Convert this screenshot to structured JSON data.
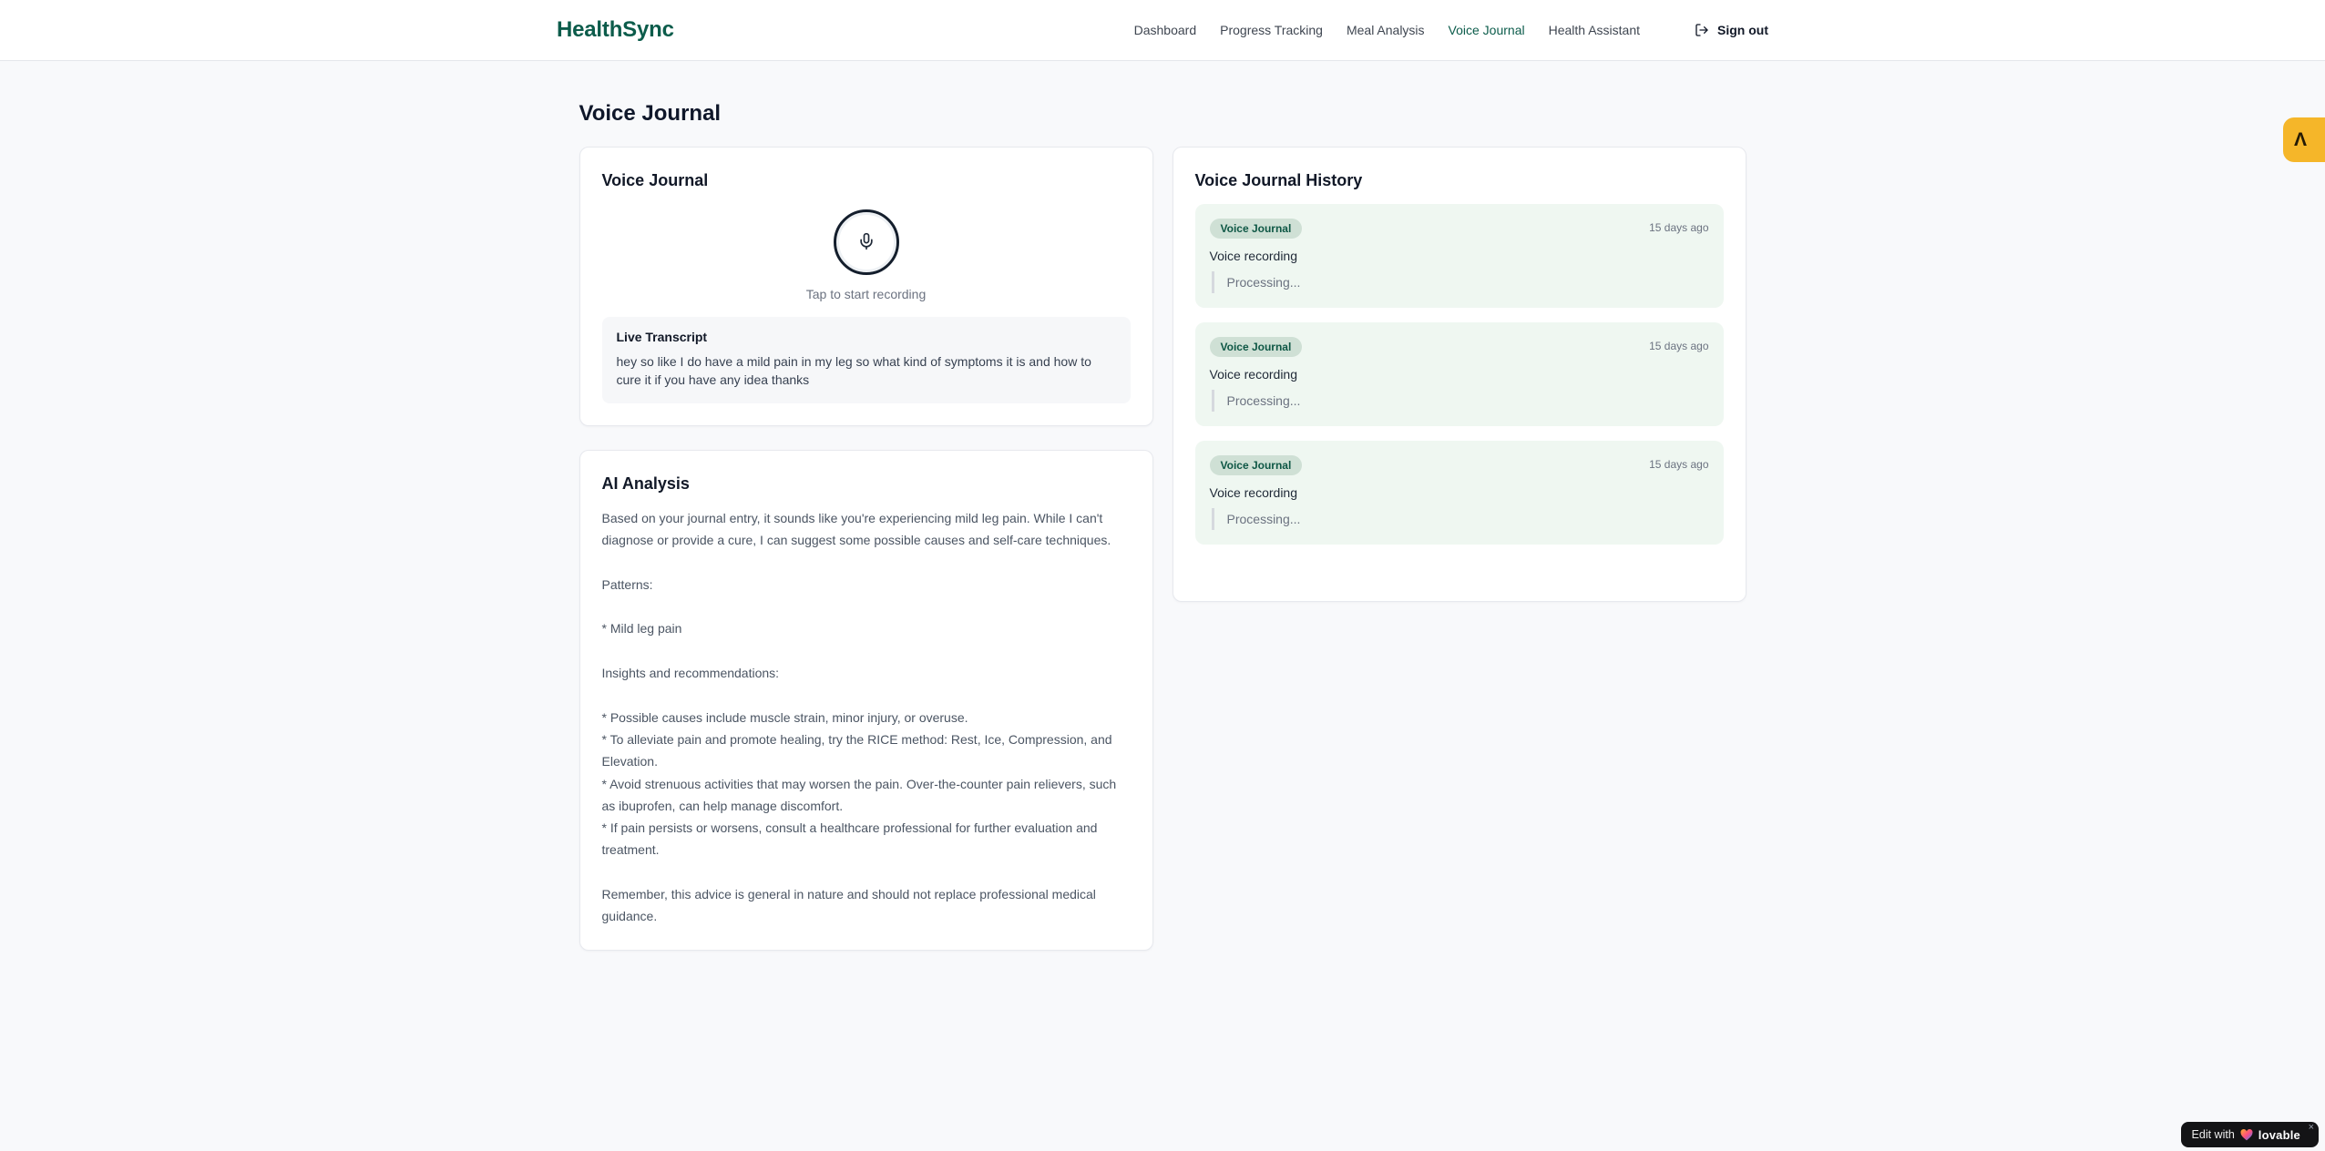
{
  "brand": {
    "name": "HealthSync",
    "color": "#0c5c4b"
  },
  "nav": {
    "items": [
      {
        "label": "Dashboard",
        "active": false
      },
      {
        "label": "Progress Tracking",
        "active": false
      },
      {
        "label": "Meal Analysis",
        "active": false
      },
      {
        "label": "Voice Journal",
        "active": true
      },
      {
        "label": "Health Assistant",
        "active": false
      }
    ],
    "sign_out_label": "Sign out"
  },
  "page": {
    "title": "Voice Journal"
  },
  "recorder_card": {
    "title": "Voice Journal",
    "tap_hint": "Tap to start recording",
    "transcript_title": "Live Transcript",
    "transcript_text": "hey so like I do have a mild pain in my leg so what kind of symptoms it is and how to cure it if you have any idea thanks"
  },
  "analysis_card": {
    "title": "AI Analysis",
    "body": "Based on your journal entry, it sounds like you're experiencing mild leg pain. While I can't diagnose or provide a cure, I can suggest some possible causes and self-care techniques.\n\nPatterns:\n\n* Mild leg pain\n\nInsights and recommendations:\n\n* Possible causes include muscle strain, minor injury, or overuse.\n* To alleviate pain and promote healing, try the RICE method: Rest, Ice, Compression, and Elevation.\n* Avoid strenuous activities that may worsen the pain. Over-the-counter pain relievers, such as ibuprofen, can help manage discomfort.\n* If pain persists or worsens, consult a healthcare professional for further evaluation and treatment.\n\nRemember, this advice is general in nature and should not replace professional medical guidance."
  },
  "history_card": {
    "title": "Voice Journal History",
    "entries": [
      {
        "badge": "Voice Journal",
        "time": "15 days ago",
        "title": "Voice recording",
        "status": "Processing..."
      },
      {
        "badge": "Voice Journal",
        "time": "15 days ago",
        "title": "Voice recording",
        "status": "Processing..."
      },
      {
        "badge": "Voice Journal",
        "time": "15 days ago",
        "title": "Voice recording",
        "status": "Processing..."
      }
    ]
  },
  "floating": {
    "side_widget_glyph": "Λ",
    "edit_badge": {
      "prefix": "Edit with",
      "brand": "lovable",
      "close": "×"
    }
  },
  "icons": {
    "sign_out": "log-out-icon",
    "microphone": "microphone-icon",
    "heart": "gradient-heart-icon"
  },
  "colors": {
    "accent_teal": "#0c5c4b",
    "entry_bg": "#eff7f1",
    "badge_bg": "#cfe0d5",
    "badge_text": "#0e5745",
    "widget_yellow": "#f5b629",
    "pill_black": "#141416",
    "page_bg": "#f8f9fb"
  }
}
